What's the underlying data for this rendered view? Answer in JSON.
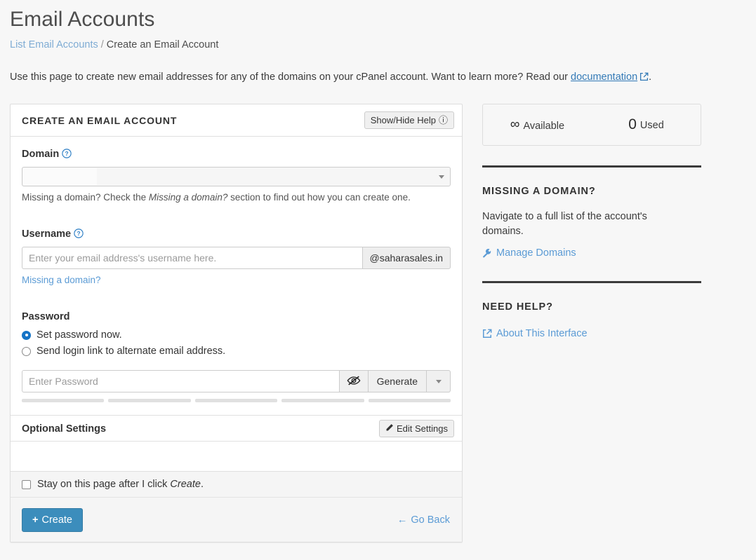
{
  "header": {
    "title": "Email Accounts",
    "breadcrumb": {
      "link": "List Email Accounts",
      "separator": "/",
      "current": "Create an Email Account"
    },
    "intro_before": "Use this page to create new email addresses for any of the domains on your cPanel account. Want to learn more? Read our ",
    "intro_link": "documentation",
    "intro_after": "."
  },
  "panel": {
    "title": "CREATE AN EMAIL ACCOUNT",
    "help_button": "Show/Hide Help",
    "help_icon": "question-circle-icon",
    "domain": {
      "label": "Domain",
      "help_icon": "question-circle-icon",
      "selected_value": "",
      "hint_before": "Missing a domain? Check the ",
      "hint_italic": "Missing a domain?",
      "hint_after": " section to find out how you can create one."
    },
    "username": {
      "label": "Username",
      "help_icon": "question-circle-icon",
      "value": "",
      "placeholder": "Enter your email address's username here.",
      "domain_addon": "@saharasales.in",
      "missing_domain_link": "Missing a domain?"
    },
    "password": {
      "label": "Password",
      "options": [
        {
          "label": "Set password now.",
          "selected": true
        },
        {
          "label": "Send login link to alternate email address.",
          "selected": false
        }
      ],
      "value": "",
      "placeholder": "Enter Password",
      "toggle_icon": "eye-slash-icon",
      "generate_label": "Generate",
      "caret_icon": "chevron-down-icon",
      "strength_segments": 5,
      "strength_filled": 0
    },
    "optional_settings": {
      "title": "Optional Settings",
      "edit_label": "Edit Settings",
      "edit_icon": "pencil-icon"
    },
    "footer": {
      "stay_before": "Stay on this page after I click ",
      "stay_italic": "Create",
      "stay_after": ".",
      "stay_checked": false,
      "create_label": "Create",
      "create_icon": "plus-icon",
      "go_back_label": "Go Back",
      "go_back_icon": "arrow-left-icon"
    }
  },
  "sidebar": {
    "stats": [
      {
        "value": "∞",
        "caption": "Available"
      },
      {
        "value": "0",
        "caption": "Used"
      }
    ],
    "missing_domain": {
      "title": "MISSING A DOMAIN?",
      "text": "Navigate to a full list of the account's domains.",
      "link": "Manage Domains",
      "link_icon": "wrench-icon"
    },
    "need_help": {
      "title": "NEED HELP?",
      "link": "About This Interface",
      "link_icon": "external-link-icon"
    }
  },
  "colors": {
    "accent": "#3c8dbc",
    "link": "#5b9bd5",
    "doc_link": "#337ab7",
    "radio_on": "#1573c6",
    "page_bg": "#f7f7f7"
  }
}
